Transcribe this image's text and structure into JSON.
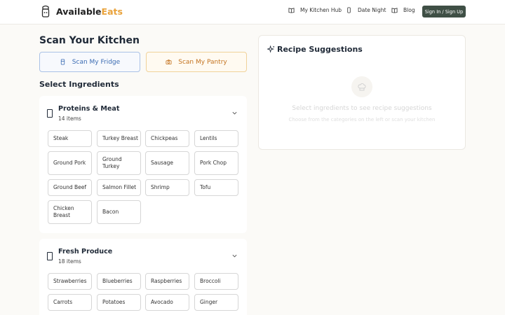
{
  "header": {
    "brand_part1": "Available",
    "brand_part2": "Eats",
    "brand_accent_color": "#e9a23b",
    "logo_icon": "chef-icon",
    "nav": [
      {
        "label": "My Kitchen Hub",
        "icon": "book-icon"
      },
      {
        "label": "Date Night",
        "icon": "phone-icon"
      },
      {
        "label": "Blog",
        "icon": "book-open-icon"
      }
    ],
    "signin_label": "Sign In / Sign Up",
    "signin_color": "#3f4f45"
  },
  "scan": {
    "title": "Scan Your Kitchen",
    "fridge_label": "Scan My Fridge",
    "fridge_icon": "fridge-icon",
    "pantry_label": "Scan My Pantry",
    "pantry_icon": "camera-icon"
  },
  "select_title": "Select Ingredients",
  "categories": [
    {
      "title": "Proteins & Meat",
      "count": "14 items",
      "items": [
        "Steak",
        "Turkey Breast",
        "Chickpeas",
        "Lentils",
        "Ground Pork",
        "Ground Turkey",
        "Sausage",
        "Pork Chop",
        "Ground Beef",
        "Salmon Fillet",
        "Shrimp",
        "Tofu",
        "Chicken Breast",
        "Bacon"
      ]
    },
    {
      "title": "Fresh Produce",
      "count": "18 items",
      "items": [
        "Strawberries",
        "Blueberries",
        "Raspberries",
        "Broccoli",
        "Carrots",
        "Potatoes",
        "Avocado",
        "Ginger"
      ]
    }
  ],
  "suggestions": {
    "title": "Recipe Suggestions",
    "icon": "sparkles-icon",
    "empty_icon": "chef-hat-icon",
    "empty_title": "Select ingredients to see recipe suggestions",
    "empty_subtitle": "Choose from the categories on the left or scan your kitchen"
  }
}
